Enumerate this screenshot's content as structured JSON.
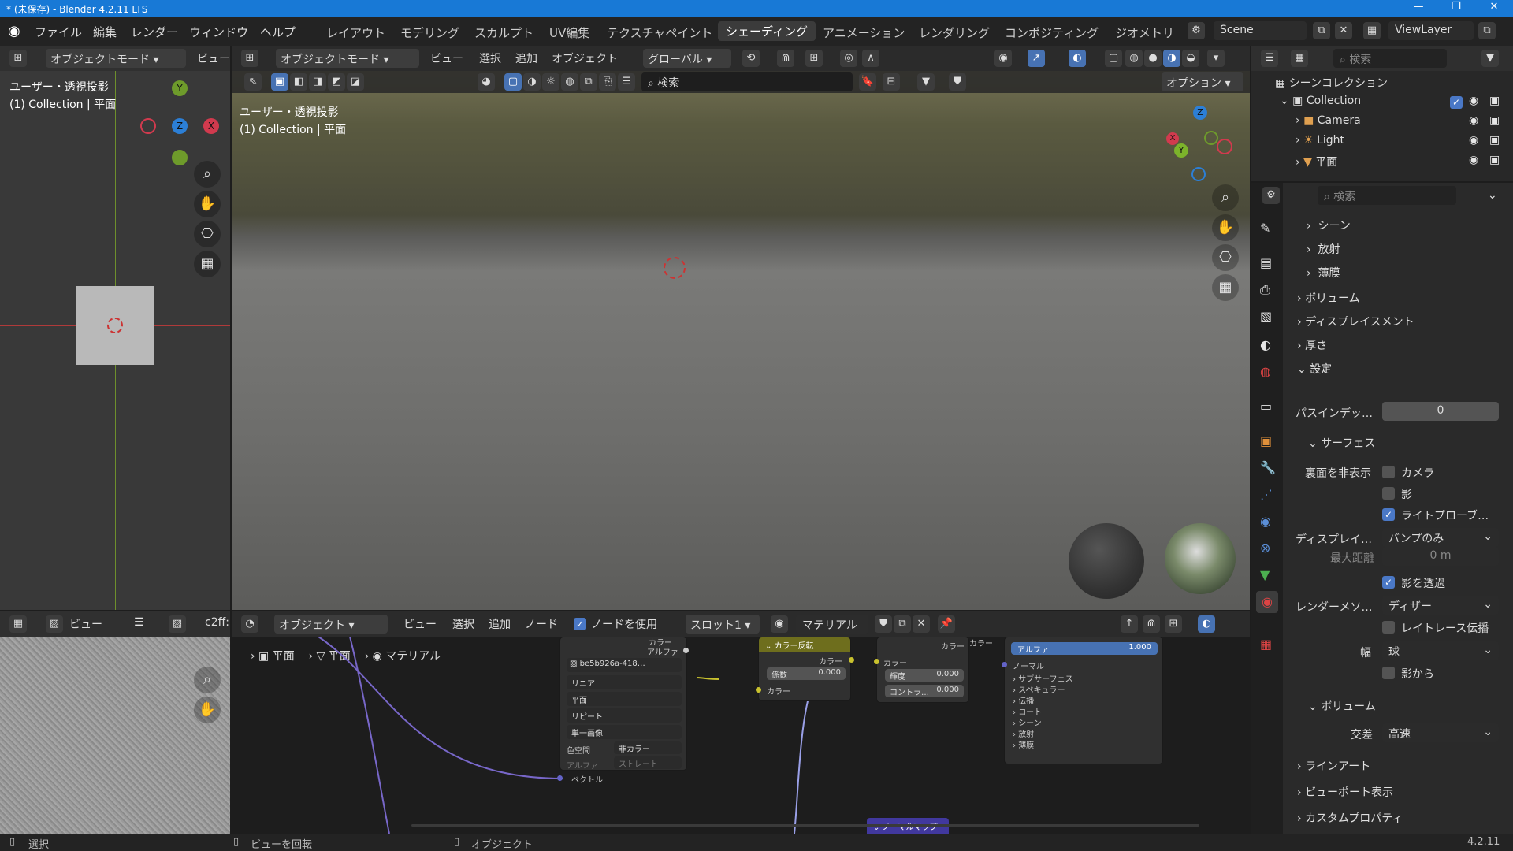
{
  "window": {
    "title": "* (未保存) - Blender 4.2.11 LTS",
    "min": "—",
    "max": "❐",
    "close": "✕"
  },
  "menu": {
    "file": "ファイル",
    "edit": "編集",
    "render": "レンダー",
    "window": "ウィンドウ",
    "help": "ヘルプ"
  },
  "workspaces": [
    "レイアウト",
    "モデリング",
    "スカルプト",
    "UV編集",
    "テクスチャペイント",
    "シェーディング",
    "アニメーション",
    "レンダリング",
    "コンポジティング",
    "ジオメトリ"
  ],
  "active_workspace": "シェーディング",
  "scene": "Scene",
  "view_layer": "ViewLayer",
  "left_view": {
    "mode": "オブジェクトモード",
    "view": "ビュー",
    "overlay_line1": "ユーザー・透視投影",
    "overlay_line2": "(1) Collection | 平面"
  },
  "viewport": {
    "mode": "オブジェクトモード",
    "view": "ビュー",
    "select": "選択",
    "add": "追加",
    "object": "オブジェクト",
    "orientation": "グローバル",
    "search_placeholder": "検索",
    "options": "オプション",
    "overlay_line1": "ユーザー・透視投影",
    "overlay_line2": "(1) Collection | 平面"
  },
  "gizmo": {
    "x": "X",
    "y": "Y",
    "z": "Z"
  },
  "outliner": {
    "search_placeholder": "検索",
    "scene_collection": "シーンコレクション",
    "collection": "Collection",
    "items": [
      "Camera",
      "Light",
      "平面"
    ]
  },
  "properties": {
    "search_placeholder": "検索",
    "sections": {
      "scene": "シーン",
      "emission": "放射",
      "thin_film": "薄膜",
      "volume": "ボリューム",
      "displacement": "ディスプレイスメント",
      "thickness": "厚さ",
      "settings": "設定",
      "surface": "サーフェス",
      "volume2": "ボリューム",
      "lineart": "ラインアート",
      "viewport_display": "ビューポート表示",
      "custom_props": "カスタムプロパティ"
    },
    "pass_index_label": "パスインデッ…",
    "pass_index_value": "0",
    "backface_label": "裏面を非表示",
    "camera": "カメラ",
    "shadow": "影",
    "light_probe": "ライトプローブ…",
    "displacement_label": "ディスプレイ…",
    "displacement_value": "バンプのみ",
    "max_distance_label": "最大距離",
    "max_distance_value": "0 m",
    "transparent_shadow": "影を透過",
    "render_method_label": "レンダーメソ…",
    "render_method_value": "ディザー",
    "raytrace": "レイトレース伝播",
    "width_label": "幅",
    "width_value": "球",
    "from_shadow": "影から",
    "intersection_label": "交差",
    "intersection_value": "高速"
  },
  "image_editor": {
    "view": "ビュー",
    "image_name": "c2ff:"
  },
  "node_editor": {
    "type": "オブジェクト",
    "view": "ビュー",
    "select": "選択",
    "add": "追加",
    "node": "ノード",
    "use_nodes": "ノードを使用",
    "slot": "スロット1",
    "material": "マテリアル",
    "breadcrumb": [
      "平面",
      "平面",
      "マテリアル"
    ]
  },
  "nodes": {
    "image_name": "be5b926a-418…",
    "interp": "リニア",
    "proj": "平面",
    "ext": "リピート",
    "source": "単一画像",
    "colorspace_label": "色空間",
    "colorspace": "非カラー",
    "alpha_label": "アルファ",
    "alpha": "ストレート",
    "vector": "ベクトル",
    "out_color": "カラー",
    "out_alpha": "アルファ",
    "invert_title": "カラー反転",
    "invert_out": "カラー",
    "factor_label": "係数",
    "factor_value": "0.000",
    "color_in": "カラー",
    "bc_out": "カラー",
    "bc_in": "カラー",
    "bright_label": "輝度",
    "bright_value": "0.000",
    "contrast_label": "コントラ…",
    "contrast_value": "0.000",
    "bsdf_color": "カラー",
    "bsdf_alpha_label": "アルファ",
    "bsdf_alpha_value": "1.000",
    "bsdf_normal": "ノーマル",
    "bsdf_items": [
      "サブサーフェス",
      "スペキュラー",
      "伝播",
      "コート",
      "シーン",
      "放射",
      "薄膜"
    ],
    "normal_map": "ノーマルマップ"
  },
  "status": {
    "select": "選択",
    "rotate": "ビューを回転",
    "object": "オブジェクト",
    "version": "4.2.11"
  }
}
